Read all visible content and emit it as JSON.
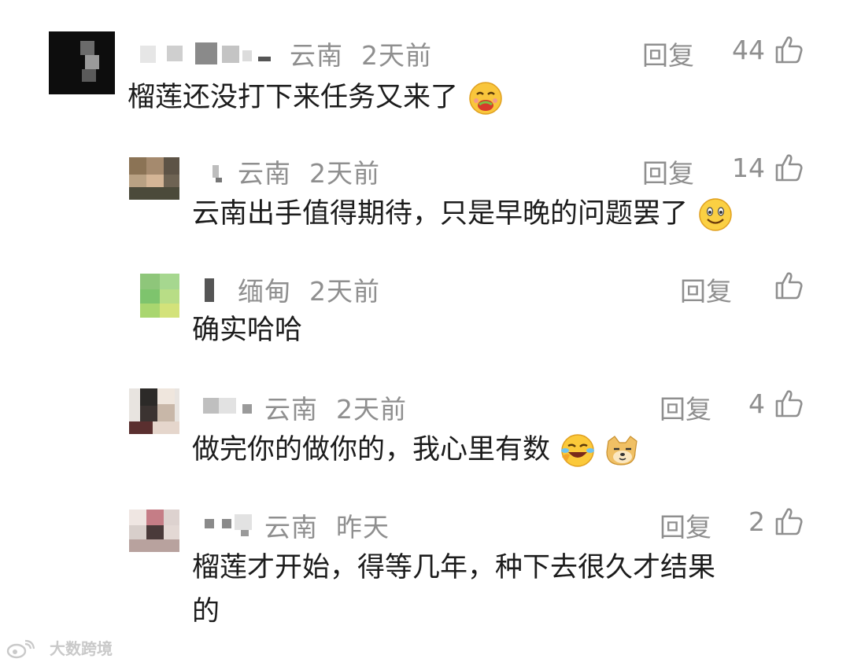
{
  "comments": [
    {
      "location": "云南",
      "time": "2天前",
      "reply_label": "回复",
      "likes": "44",
      "text": "榴莲还没打下来任务又来了",
      "emojis": [
        "food-emoji"
      ]
    },
    {
      "location": "云南",
      "time": "2天前",
      "reply_label": "回复",
      "likes": "14",
      "text": "云南出手值得期待，只是早晚的问题罢了",
      "emojis": [
        "smile-emoji"
      ]
    },
    {
      "location": "缅甸",
      "time": "2天前",
      "reply_label": "回复",
      "likes": "",
      "text": "确实哈哈",
      "emojis": []
    },
    {
      "location": "云南",
      "time": "2天前",
      "reply_label": "回复",
      "likes": "4",
      "text": "做完你的做你的，我心里有数",
      "emojis": [
        "laugh-cry-emoji",
        "doge-emoji"
      ]
    },
    {
      "location": "云南",
      "time": "昨天",
      "reply_label": "回复",
      "likes": "2",
      "text_line1": "榴莲才开始，得等几年，种下去很久才结果",
      "text_line2": "的",
      "emojis": []
    }
  ],
  "watermark": {
    "text": "大数跨境",
    "logo_icon": "weibo-logo-icon"
  },
  "colors": {
    "meta": "#8f8f8f",
    "text": "#1c1c1c",
    "background": "#ffffff"
  }
}
